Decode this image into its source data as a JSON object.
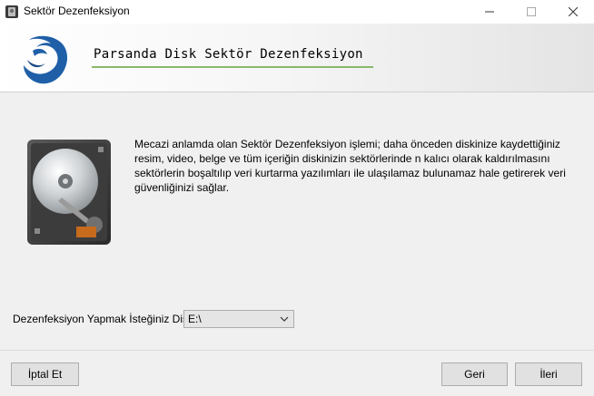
{
  "window": {
    "title": "Sektör Dezenfeksiyon",
    "controls": {
      "minimize": "—",
      "maximize": "☐",
      "close": "✕"
    }
  },
  "header": {
    "title": "Parsanda Disk Sektör Dezenfeksiyon",
    "logo_icon": "panther-logo-icon",
    "accent_color": "#8ab86a",
    "logo_color": "#1f5fa8"
  },
  "main": {
    "illustration_icon": "hard-disk-icon",
    "description": "Mecazi anlamda olan Sektör Dezenfeksiyon işlemi; daha önceden diskinize kaydettiğiniz resim, video, belge ve tüm içeriğin diskinizin sektörlerinde n kalıcı olarak kaldırılmasını sektörlerin boşaltılıp veri kurtarma yazılımları ile ulaşılamaz bulunamaz hale getirerek veri güvenliğinizi sağlar.",
    "disk_label": "Dezenfeksiyon Yapmak İsteğiniz Disk",
    "disk_selected": "E:\\"
  },
  "footer": {
    "cancel_label": "İptal Et",
    "back_label": "Geri",
    "next_label": "İleri"
  }
}
